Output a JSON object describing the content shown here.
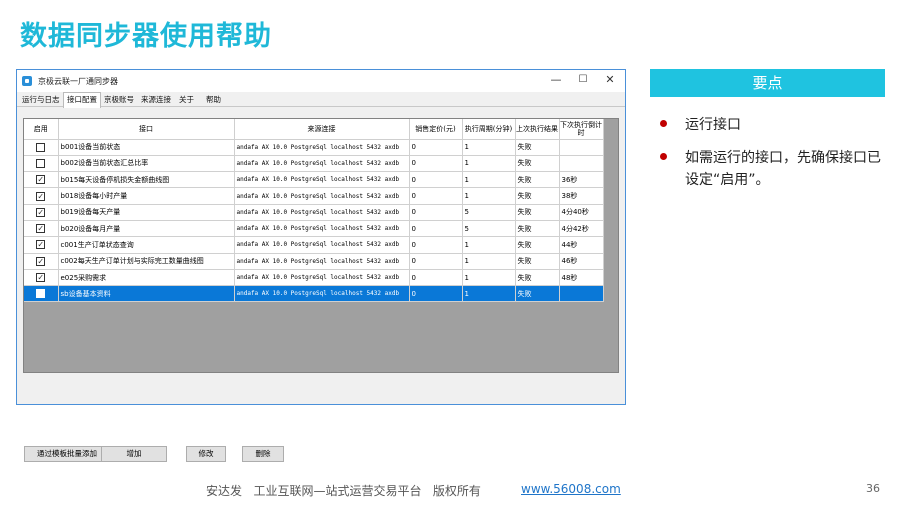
{
  "slide": {
    "title": "数据同步器使用帮助",
    "key_points_header": "要点",
    "bullets": [
      "运行接口",
      "如需运行的接口，先确保接口已设定“启用”。"
    ],
    "footer_text": "安达发   工业互联网—站式运营交易平台   版权所有",
    "footer_link": "www.56008.com",
    "page_number": "36",
    "colors": {
      "title": "#1fb8d8",
      "banner": "#1fc3e0",
      "bullet": "#c00000",
      "selected_row": "#0a78d7"
    }
  },
  "window": {
    "title": "京极云联一厂通同步器",
    "controls": {
      "minimize": "—",
      "maximize": "☐",
      "close": "✕"
    },
    "tabs": [
      "运行与日志",
      "接口配置",
      "京极账号",
      "来源连接",
      "关于",
      "帮助"
    ],
    "active_tab": "接口配置",
    "table": {
      "headers": [
        "启用",
        "接口",
        "来源连接",
        "销售定价(元)",
        "执行周期(分钟)",
        "上次执行结果",
        "下次执行倒计时"
      ],
      "rows": [
        {
          "enabled": false,
          "name": "b001设备当前状态",
          "connection": "andafa AX 10.0 PostgreSql localhost 5432 axdb",
          "price": "0",
          "period": "1",
          "result": "失败",
          "countdown": ""
        },
        {
          "enabled": false,
          "name": "b002设备当前状态汇总比率",
          "connection": "andafa AX 10.0 PostgreSql localhost 5432 axdb",
          "price": "0",
          "period": "1",
          "result": "失败",
          "countdown": ""
        },
        {
          "enabled": true,
          "name": "b015每天设备停机损失金额曲线图",
          "connection": "andafa AX 10.0 PostgreSql localhost 5432 axdb",
          "price": "0",
          "period": "1",
          "result": "失败",
          "countdown": "36秒"
        },
        {
          "enabled": true,
          "name": "b018设备每小时产量",
          "connection": "andafa AX 10.0 PostgreSql localhost 5432 axdb",
          "price": "0",
          "period": "1",
          "result": "失败",
          "countdown": "38秒"
        },
        {
          "enabled": true,
          "name": "b019设备每天产量",
          "connection": "andafa AX 10.0 PostgreSql localhost 5432 axdb",
          "price": "0",
          "period": "5",
          "result": "失败",
          "countdown": "4分40秒"
        },
        {
          "enabled": true,
          "name": "b020设备每月产量",
          "connection": "andafa AX 10.0 PostgreSql localhost 5432 axdb",
          "price": "0",
          "period": "5",
          "result": "失败",
          "countdown": "4分42秒"
        },
        {
          "enabled": true,
          "name": "c001生产订单状态查询",
          "connection": "andafa AX 10.0 PostgreSql localhost 5432 axdb",
          "price": "0",
          "period": "1",
          "result": "失败",
          "countdown": "44秒"
        },
        {
          "enabled": true,
          "name": "c002每天生产订单计划与实际完工数量曲线图",
          "connection": "andafa AX 10.0 PostgreSql localhost 5432 axdb",
          "price": "0",
          "period": "1",
          "result": "失败",
          "countdown": "46秒"
        },
        {
          "enabled": true,
          "name": "e025采购需求",
          "connection": "andafa AX 10.0 PostgreSql localhost 5432 axdb",
          "price": "0",
          "period": "1",
          "result": "失败",
          "countdown": "48秒"
        },
        {
          "enabled": false,
          "name": "sb设备基本资料",
          "connection": "andafa AX 10.0 PostgreSql localhost 5432 axdb",
          "price": "0",
          "period": "1",
          "result": "失败",
          "countdown": "",
          "selected": true
        }
      ]
    },
    "buttons": [
      "通过模板批量添加",
      "增加",
      "修改",
      "删除"
    ]
  }
}
